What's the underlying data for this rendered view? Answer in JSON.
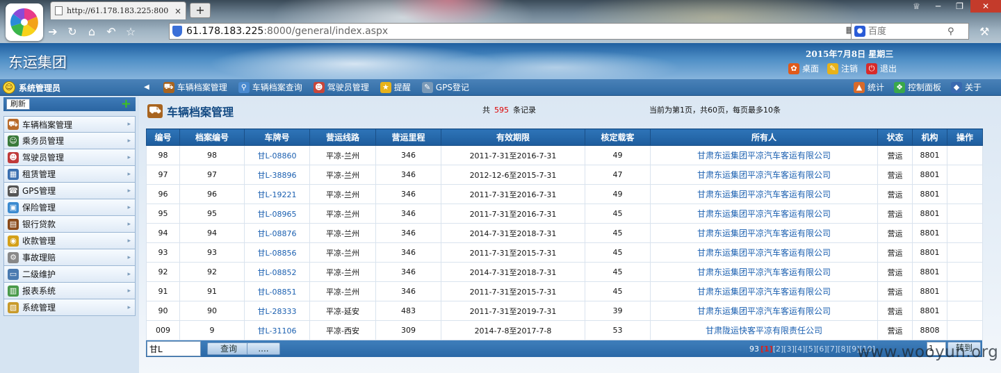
{
  "browser": {
    "tab_title": "http://61.178.183.225:800",
    "tab_close": "×",
    "new_tab": "+",
    "url_host": "61.178.183.225",
    "url_rest": ":8000/general/index.aspx",
    "search_placeholder": "百度"
  },
  "header": {
    "title": "东运集团",
    "date": "2015年7月8日  星期三",
    "links": [
      {
        "label": "桌面",
        "icon": "desktop-icon"
      },
      {
        "label": "注销",
        "icon": "logout-icon"
      },
      {
        "label": "退出",
        "icon": "exit-icon"
      }
    ]
  },
  "toolbar": {
    "user": "系统管理员",
    "items": [
      {
        "label": "车辆档案管理",
        "icon": "truck-icon"
      },
      {
        "label": "车辆档案查询",
        "icon": "magnifier-icon"
      },
      {
        "label": "驾驶员管理",
        "icon": "driver-icon"
      },
      {
        "label": "提醒",
        "icon": "star-icon"
      },
      {
        "label": "GPS登记",
        "icon": "document-icon"
      }
    ],
    "right_items": [
      {
        "label": "统计",
        "icon": "chart-icon"
      },
      {
        "label": "控制面板",
        "icon": "control-panel-icon"
      },
      {
        "label": "关于",
        "icon": "about-icon"
      }
    ]
  },
  "sidebar": {
    "refresh": "刷新",
    "items": [
      {
        "label": "车辆档案管理",
        "icon": "truck-icon",
        "color": "#b86a2a"
      },
      {
        "label": "乘务员管理",
        "icon": "people-icon",
        "color": "#3a7a3a"
      },
      {
        "label": "驾驶员管理",
        "icon": "driver-icon",
        "color": "#c03a3a"
      },
      {
        "label": "租赁管理",
        "icon": "grid-icon",
        "color": "#3a6fb0"
      },
      {
        "label": "GPS管理",
        "icon": "phone-icon",
        "color": "#555555"
      },
      {
        "label": "保险管理",
        "icon": "building-icon",
        "color": "#3a8ad0"
      },
      {
        "label": "银行贷款",
        "icon": "briefcase-icon",
        "color": "#8a4a1a"
      },
      {
        "label": "收款管理",
        "icon": "coins-icon",
        "color": "#d4a018"
      },
      {
        "label": "事故理赔",
        "icon": "gear-icon",
        "color": "#888888"
      },
      {
        "label": "二级维护",
        "icon": "window-icon",
        "color": "#4a7ab0"
      },
      {
        "label": "报表系统",
        "icon": "report-icon",
        "color": "#4a9a4a"
      },
      {
        "label": "系统管理",
        "icon": "folder-icon",
        "color": "#c89a2a"
      }
    ]
  },
  "main": {
    "title": "车辆档案管理",
    "summary_prefix": "共",
    "summary_count": "595",
    "summary_suffix": "条记录",
    "page_info": "当前为第1页，共60页，每页最多10条",
    "columns": [
      "编号",
      "档案编号",
      "车牌号",
      "营运线路",
      "营运里程",
      "有效期限",
      "核定载客",
      "所有人",
      "状态",
      "机构",
      "操作"
    ],
    "rows": [
      [
        "98",
        "98",
        "甘L-08860",
        "平凉-兰州",
        "346",
        "2011-7-31至2016-7-31",
        "49",
        "甘肃东运集团平凉汽车客运有限公司",
        "营运",
        "8801",
        ""
      ],
      [
        "97",
        "97",
        "甘L-38896",
        "平凉-兰州",
        "346",
        "2012-12-6至2015-7-31",
        "47",
        "甘肃东运集团平凉汽车客运有限公司",
        "营运",
        "8801",
        ""
      ],
      [
        "96",
        "96",
        "甘L-19221",
        "平凉-兰州",
        "346",
        "2011-7-31至2016-7-31",
        "49",
        "甘肃东运集团平凉汽车客运有限公司",
        "营运",
        "8801",
        ""
      ],
      [
        "95",
        "95",
        "甘L-08965",
        "平凉-兰州",
        "346",
        "2011-7-31至2016-7-31",
        "45",
        "甘肃东运集团平凉汽车客运有限公司",
        "营运",
        "8801",
        ""
      ],
      [
        "94",
        "94",
        "甘L-08876",
        "平凉-兰州",
        "346",
        "2014-7-31至2018-7-31",
        "45",
        "甘肃东运集团平凉汽车客运有限公司",
        "营运",
        "8801",
        ""
      ],
      [
        "93",
        "93",
        "甘L-08856",
        "平凉-兰州",
        "346",
        "2011-7-31至2015-7-31",
        "45",
        "甘肃东运集团平凉汽车客运有限公司",
        "营运",
        "8801",
        ""
      ],
      [
        "92",
        "92",
        "甘L-08852",
        "平凉-兰州",
        "346",
        "2014-7-31至2018-7-31",
        "45",
        "甘肃东运集团平凉汽车客运有限公司",
        "营运",
        "8801",
        ""
      ],
      [
        "91",
        "91",
        "甘L-08851",
        "平凉-兰州",
        "346",
        "2011-7-31至2015-7-31",
        "45",
        "甘肃东运集团平凉汽车客运有限公司",
        "营运",
        "8801",
        ""
      ],
      [
        "90",
        "90",
        "甘L-28333",
        "平凉-延安",
        "483",
        "2011-7-31至2019-7-31",
        "39",
        "甘肃东运集团平凉汽车客运有限公司",
        "营运",
        "8801",
        ""
      ],
      [
        "009",
        "9",
        "甘L-31106",
        "平凉-西安",
        "309",
        "2014-7-8至2017-7-8",
        "53",
        "甘肃陇运快客平凉有限责任公司",
        "营运",
        "8808",
        ""
      ]
    ],
    "search_value": "甘L",
    "query_label": "查询",
    "more_label": "....",
    "pager_total": "93",
    "pager_current": "[1]",
    "pager_pages": "[2][3][4][5][6][7][8][9][10]",
    "pager_go_value": "1",
    "pager_go_label": "转到"
  },
  "watermark": "www.wooyun.org"
}
